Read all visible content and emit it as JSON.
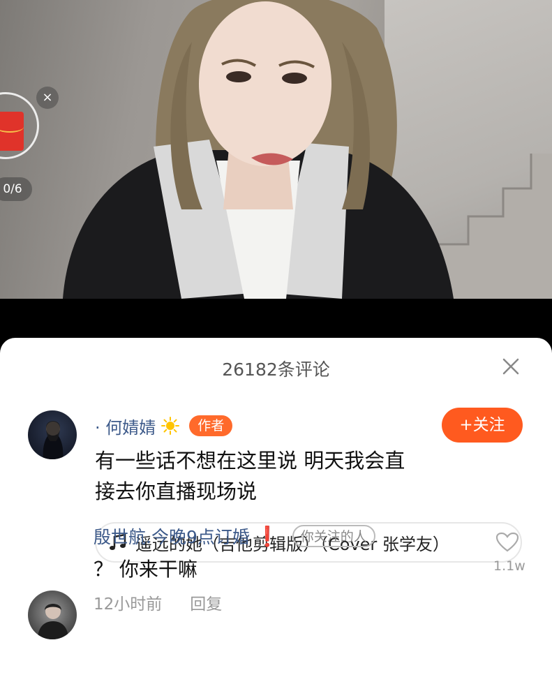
{
  "video": {
    "redpacket_count": "0/6",
    "close_glyph": "×"
  },
  "comments_sheet": {
    "title": "26182条评论",
    "close_icon": "close-icon"
  },
  "comment_author": {
    "name": "· 何婧婧",
    "badge_icon": "sun-icon",
    "author_badge": "作者",
    "follow_button": "+关注",
    "text_line1": "有一些话不想在这里说 明天我会直",
    "text_line2": "接去你直播现场说",
    "music_icon": "music-note-icon",
    "music": "遥远的她（吉他剪辑版）（Cover 张学友）"
  },
  "comment_reply": {
    "name": "殷世航.今晚9点订婚",
    "exclamation": "❗",
    "follow_tag": "你关注的人",
    "text": "？ 你来干嘛",
    "time": "12小时前",
    "reply_button": "回复",
    "like_icon": "heart-icon",
    "like_count": "1.1w"
  },
  "colors": {
    "accent": "#ff5a1f",
    "username": "#3d5a8a",
    "muted": "#999999"
  }
}
